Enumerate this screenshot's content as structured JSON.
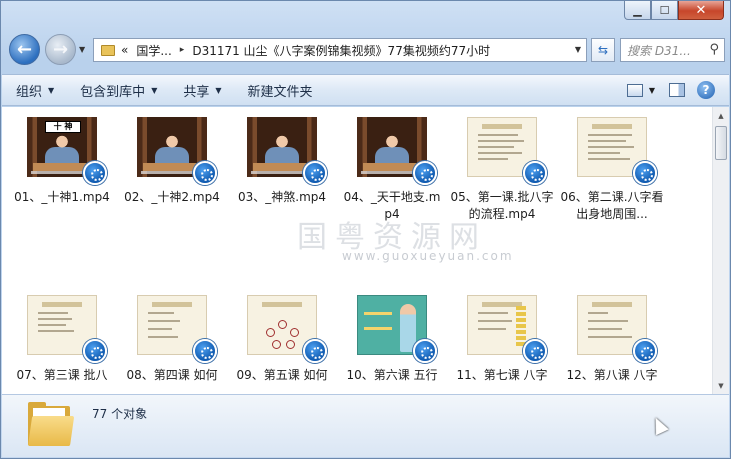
{
  "window": {
    "controls": {
      "minimize": "▁",
      "maximize": "☐",
      "close": "✕"
    }
  },
  "address_bar": {
    "overflow": "«",
    "parts": [
      "国学...",
      "D31171 山尘《八字案例锦集视频》77集视频约77小时"
    ],
    "separator": "▸"
  },
  "search": {
    "placeholder": "搜索 D31...",
    "icon": "search-icon"
  },
  "toolbar": {
    "organize": "组织",
    "include_in_library": "包含到库中",
    "share": "共享",
    "new_folder": "新建文件夹"
  },
  "watermark": {
    "text": "国粤资源网",
    "url": "www.guoxueyuan.com"
  },
  "files": [
    {
      "label": "01、_十神1.mp4",
      "kind": "video",
      "top_text": "十 神"
    },
    {
      "label": "02、_十神2.mp4",
      "kind": "video"
    },
    {
      "label": "03、_神煞.mp4",
      "kind": "video"
    },
    {
      "label": "04、_天干地支.mp4",
      "kind": "video"
    },
    {
      "label": "05、第一课.批八字的流程.mp4",
      "kind": "slide"
    },
    {
      "label": "06、第二课.八字看出身地周围...",
      "kind": "slide"
    },
    {
      "label": "07、第三课 批八",
      "kind": "slide"
    },
    {
      "label": "08、第四课 如何",
      "kind": "slide"
    },
    {
      "label": "09、第五课 如何",
      "kind": "slide-mind"
    },
    {
      "label": "10、第六课 五行",
      "kind": "slide-teal"
    },
    {
      "label": "11、第七课 八字",
      "kind": "slide-table"
    },
    {
      "label": "12、第八课 八字",
      "kind": "slide"
    }
  ],
  "status": {
    "object_count": "77 个对象"
  }
}
